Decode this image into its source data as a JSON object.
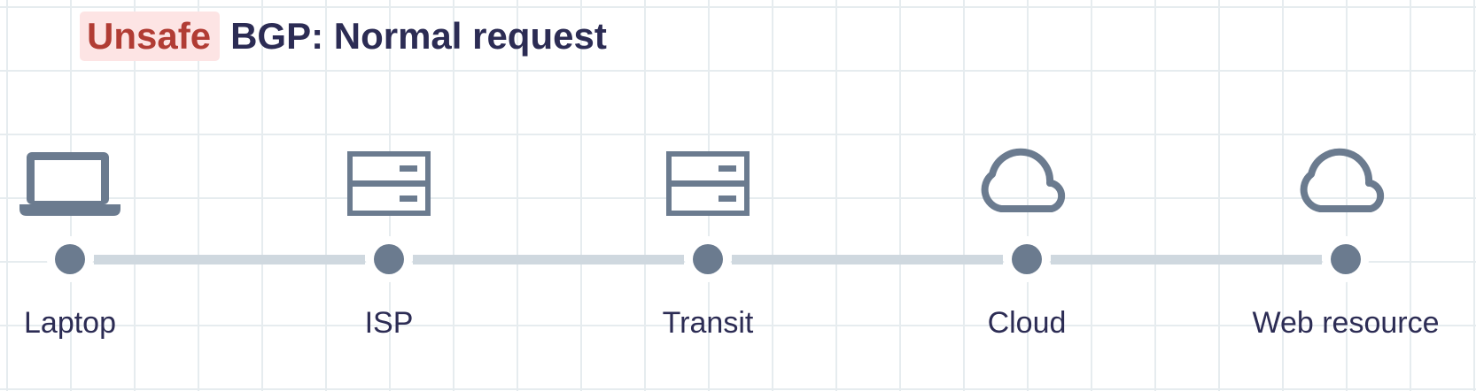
{
  "title": {
    "badge": "Unsafe",
    "text": "BGP: Normal request"
  },
  "colors": {
    "badge_bg": "#fde4e4",
    "badge_text": "#b13c34",
    "heading_text": "#2c2c54",
    "icon": "#6b7b8f",
    "link": "#cfd8df",
    "grid": "#e6ecef"
  },
  "nodes": [
    {
      "id": "laptop",
      "label": "Laptop",
      "icon": "laptop-icon"
    },
    {
      "id": "isp",
      "label": "ISP",
      "icon": "server-icon"
    },
    {
      "id": "transit",
      "label": "Transit",
      "icon": "server-icon"
    },
    {
      "id": "cloud",
      "label": "Cloud",
      "icon": "cloud-icon"
    },
    {
      "id": "web",
      "label": "Web resource",
      "icon": "cloud-icon"
    }
  ]
}
